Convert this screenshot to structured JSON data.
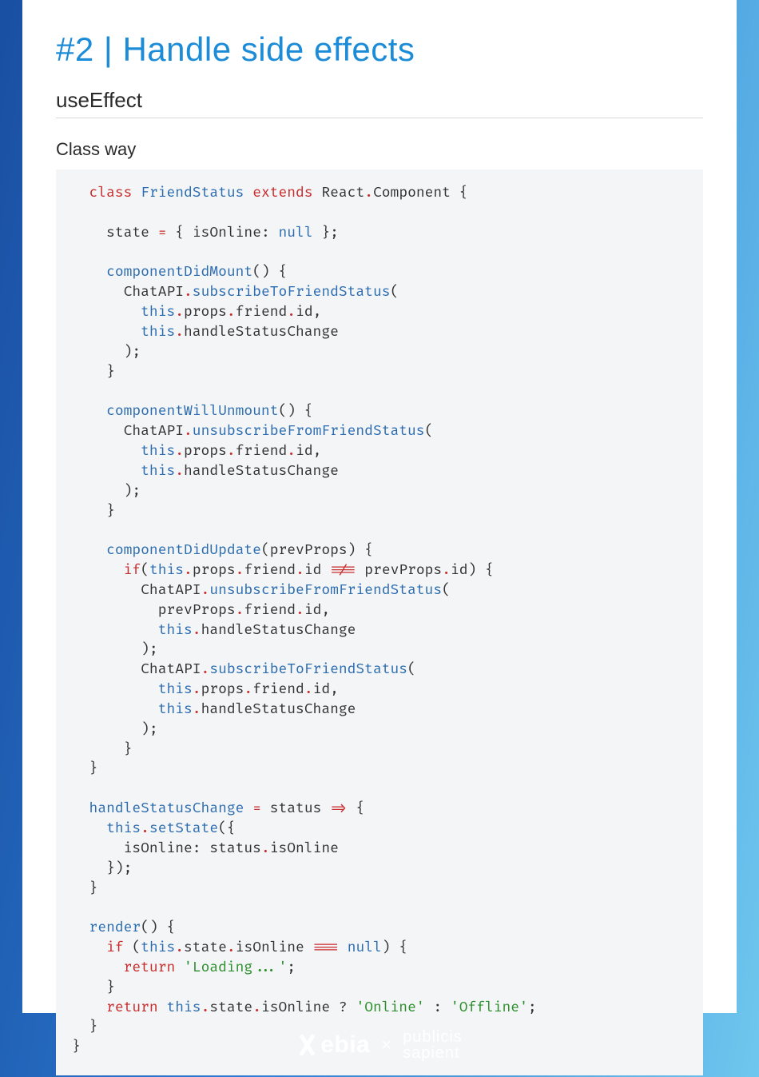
{
  "title": "#2 | Handle side effects",
  "section": "useEffect",
  "subheading": "Class way",
  "footer": {
    "brand1": "ebia",
    "sep": "×",
    "brand2a": "publicis",
    "brand2b": "sapient"
  },
  "code": {
    "l1": {
      "class": "class",
      "name": "FriendStatus",
      "extends": "extends",
      "react": "React",
      "comp": "Component"
    },
    "l3": {
      "state": "state",
      "isOnline": "isOnline",
      "null": "null"
    },
    "l5": {
      "fn": "componentDidMount"
    },
    "l6": {
      "api": "ChatAPI",
      "call": "subscribeToFriendStatus"
    },
    "l7": {
      "this": "this",
      "props": "props",
      "friend": "friend",
      "id": "id"
    },
    "l8": {
      "this": "this",
      "handle": "handleStatusChange"
    },
    "l12": {
      "fn": "componentWillUnmount"
    },
    "l13": {
      "api": "ChatAPI",
      "call": "unsubscribeFromFriendStatus"
    },
    "l19": {
      "fn": "componentDidUpdate",
      "param": "prevProps"
    },
    "l20": {
      "if": "if",
      "neq": "!==",
      "prev": "prevProps",
      "id": "id"
    },
    "l23": {
      "prev": "prevProps",
      "friend": "friend",
      "id": "id"
    },
    "l31": {
      "fn": "handleStatusChange",
      "param": "status",
      "arrow": "=>"
    },
    "l32": {
      "set": "setState"
    },
    "l33": {
      "isOnline": "isOnline",
      "status": "status"
    },
    "l37": {
      "fn": "render"
    },
    "l38": {
      "if": "if",
      "state": "state",
      "isOnline": "isOnline",
      "eqq": "===",
      "null": "null"
    },
    "l39": {
      "return": "return",
      "str": "'Loading...'"
    },
    "l41": {
      "return": "return",
      "on": "'Online'",
      "off": "'Offline'"
    }
  }
}
